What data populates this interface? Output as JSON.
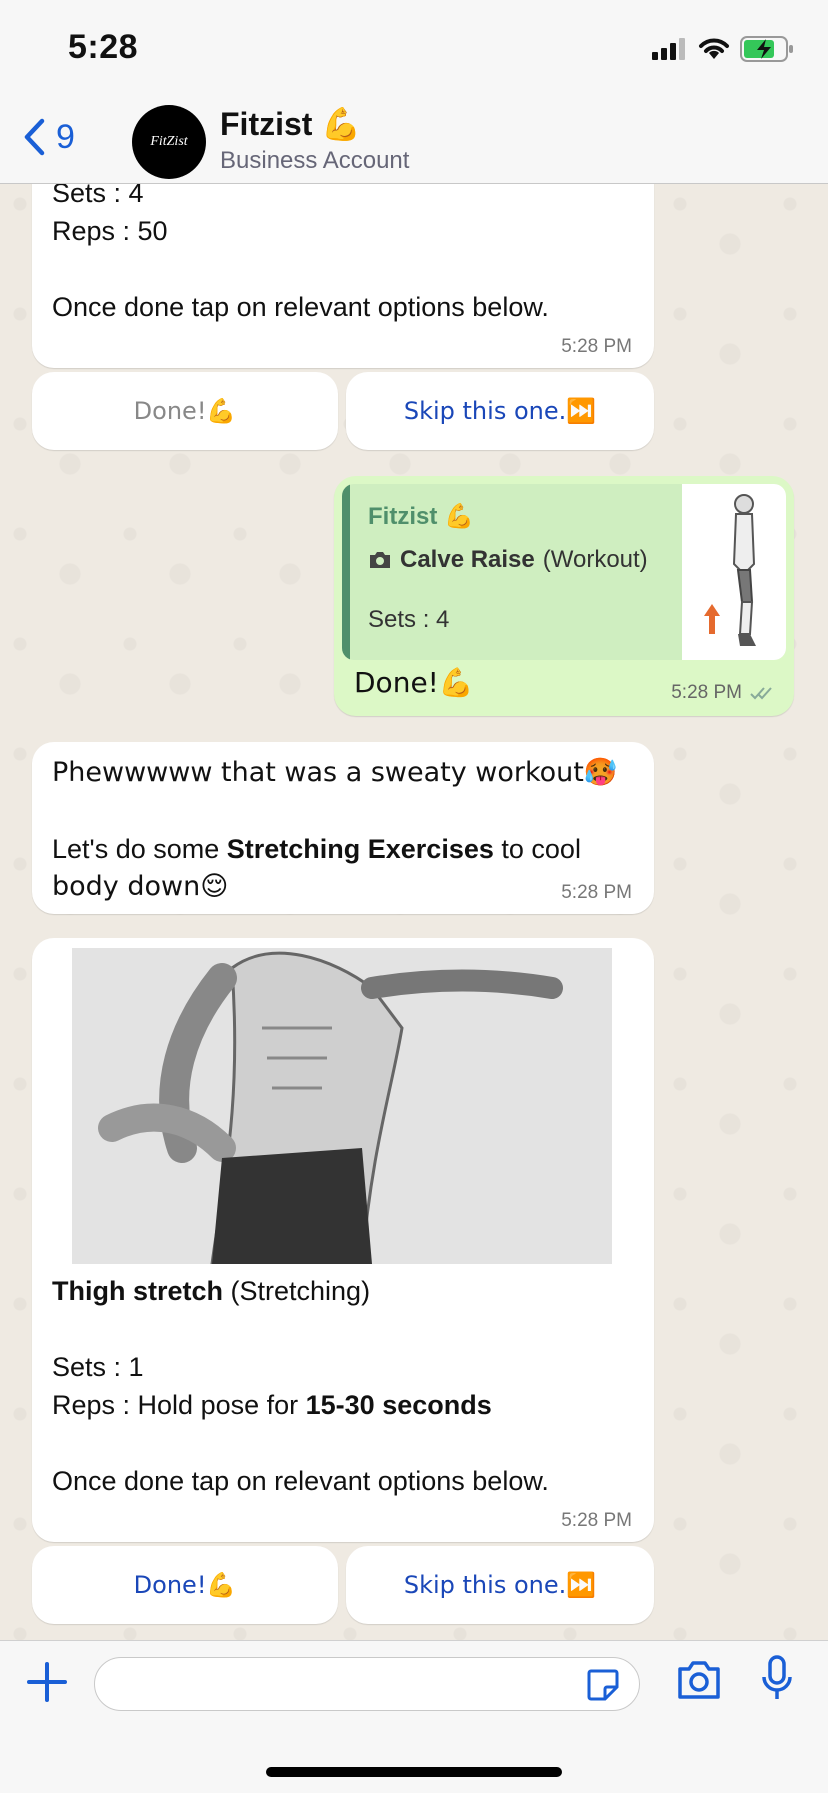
{
  "status": {
    "time": "5:28"
  },
  "header": {
    "back_count": "9",
    "avatar_text": "FitZist",
    "name": "Fitzist 💪",
    "subtitle": "Business Account"
  },
  "colors": {
    "accent": "#1a5fd6",
    "incoming": "#ffffff",
    "outgoing": "#dcf8c6",
    "quote_bar": "#4f8f6b"
  },
  "messages": {
    "m1": {
      "line1": "Sets : 4",
      "line2": "Reps : 50",
      "line3": "Once done tap on relevant options below.",
      "time": "5:28 PM"
    },
    "buttons1": {
      "done": "Done!💪",
      "skip": "Skip this one.⏭️"
    },
    "m2": {
      "quote_author": "Fitzist 💪",
      "quote_title": "Calve Raise",
      "quote_type": "(Workout)",
      "quote_sets": "Sets : 4",
      "text": "Done!💪",
      "time": "5:28 PM",
      "read_icon": "double-check-icon"
    },
    "m3": {
      "line1": "Phewwwww that was a sweaty workout🥵",
      "line2_pre": "Let's do some ",
      "line2_bold": "Stretching Exercises",
      "line2_post": " to cool",
      "line3": "body down😌",
      "time": "5:28 PM"
    },
    "m4": {
      "title": "Thigh stretch",
      "type": " (Stretching)",
      "sets": "Sets : 1",
      "reps_pre": "Reps : Hold pose for ",
      "reps_bold": "15-30 seconds",
      "footer": "Once done tap on relevant options below.",
      "time": "5:28 PM"
    },
    "buttons2": {
      "done": "Done!💪",
      "skip": "Skip this one.⏭️"
    }
  },
  "input": {
    "placeholder": ""
  }
}
